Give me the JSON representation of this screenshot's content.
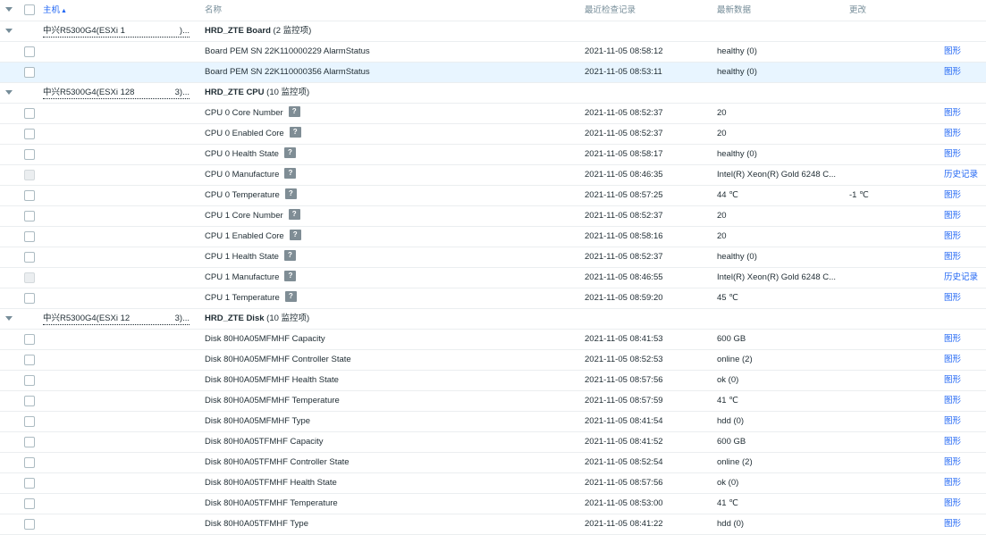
{
  "header": {
    "host": "主机",
    "sort_icon": "▲",
    "name": "名称",
    "last_check": "最近检查记录",
    "latest_data": "最新数据",
    "change": "更改"
  },
  "groups": [
    {
      "host": "中兴R5300G4(ESXi 1",
      "host_tail": ")...",
      "title": "HRD_ZTE Board",
      "count": " (2 监控项)",
      "items": [
        {
          "name": "Board PEM SN 22K110000229 AlarmStatus",
          "last": "2021-11-05 08:58:12",
          "data": "healthy (0)",
          "change": "",
          "link": "图形",
          "help": false,
          "selected": false,
          "disabled": false
        },
        {
          "name": "Board PEM SN 22K110000356 AlarmStatus",
          "last": "2021-11-05 08:53:11",
          "data": "healthy (0)",
          "change": "",
          "link": "图形",
          "help": false,
          "selected": true,
          "disabled": false
        }
      ]
    },
    {
      "host": "中兴R5300G4(ESXi 128",
      "host_tail": "3)...",
      "title": "HRD_ZTE CPU",
      "count": " (10 监控项)",
      "items": [
        {
          "name": "CPU 0 Core Number",
          "last": "2021-11-05 08:52:37",
          "data": "20",
          "change": "",
          "link": "图形",
          "help": true,
          "selected": false,
          "disabled": false
        },
        {
          "name": "CPU 0 Enabled Core",
          "last": "2021-11-05 08:52:37",
          "data": "20",
          "change": "",
          "link": "图形",
          "help": true,
          "selected": false,
          "disabled": false
        },
        {
          "name": "CPU 0 Health State",
          "last": "2021-11-05 08:58:17",
          "data": "healthy (0)",
          "change": "",
          "link": "图形",
          "help": true,
          "selected": false,
          "disabled": false
        },
        {
          "name": "CPU 0 Manufacture",
          "last": "2021-11-05 08:46:35",
          "data": "Intel(R) Xeon(R) Gold 6248 C...",
          "change": "",
          "link": "历史记录",
          "help": true,
          "selected": false,
          "disabled": true
        },
        {
          "name": "CPU 0 Temperature",
          "last": "2021-11-05 08:57:25",
          "data": "44 ℃",
          "change": "-1 ℃",
          "link": "图形",
          "help": true,
          "selected": false,
          "disabled": false
        },
        {
          "name": "CPU 1 Core Number",
          "last": "2021-11-05 08:52:37",
          "data": "20",
          "change": "",
          "link": "图形",
          "help": true,
          "selected": false,
          "disabled": false
        },
        {
          "name": "CPU 1 Enabled Core",
          "last": "2021-11-05 08:58:16",
          "data": "20",
          "change": "",
          "link": "图形",
          "help": true,
          "selected": false,
          "disabled": false
        },
        {
          "name": "CPU 1 Health State",
          "last": "2021-11-05 08:52:37",
          "data": "healthy (0)",
          "change": "",
          "link": "图形",
          "help": true,
          "selected": false,
          "disabled": false
        },
        {
          "name": "CPU 1 Manufacture",
          "last": "2021-11-05 08:46:55",
          "data": "Intel(R) Xeon(R) Gold 6248 C...",
          "change": "",
          "link": "历史记录",
          "help": true,
          "selected": false,
          "disabled": true
        },
        {
          "name": "CPU 1 Temperature",
          "last": "2021-11-05 08:59:20",
          "data": "45 ℃",
          "change": "",
          "link": "图形",
          "help": true,
          "selected": false,
          "disabled": false
        }
      ]
    },
    {
      "host": "中兴R5300G4(ESXi 12",
      "host_tail": "3)...",
      "title": "HRD_ZTE Disk",
      "count": " (10 监控项)",
      "items": [
        {
          "name": "Disk 80H0A05MFMHF Capacity",
          "last": "2021-11-05 08:41:53",
          "data": "600 GB",
          "change": "",
          "link": "图形",
          "help": false,
          "selected": false,
          "disabled": false
        },
        {
          "name": "Disk 80H0A05MFMHF Controller State",
          "last": "2021-11-05 08:52:53",
          "data": "online (2)",
          "change": "",
          "link": "图形",
          "help": false,
          "selected": false,
          "disabled": false
        },
        {
          "name": "Disk 80H0A05MFMHF Health State",
          "last": "2021-11-05 08:57:56",
          "data": "ok (0)",
          "change": "",
          "link": "图形",
          "help": false,
          "selected": false,
          "disabled": false
        },
        {
          "name": "Disk 80H0A05MFMHF Temperature",
          "last": "2021-11-05 08:57:59",
          "data": "41 ℃",
          "change": "",
          "link": "图形",
          "help": false,
          "selected": false,
          "disabled": false
        },
        {
          "name": "Disk 80H0A05MFMHF Type",
          "last": "2021-11-05 08:41:54",
          "data": "hdd (0)",
          "change": "",
          "link": "图形",
          "help": false,
          "selected": false,
          "disabled": false
        },
        {
          "name": "Disk 80H0A05TFMHF Capacity",
          "last": "2021-11-05 08:41:52",
          "data": "600 GB",
          "change": "",
          "link": "图形",
          "help": false,
          "selected": false,
          "disabled": false
        },
        {
          "name": "Disk 80H0A05TFMHF Controller State",
          "last": "2021-11-05 08:52:54",
          "data": "online (2)",
          "change": "",
          "link": "图形",
          "help": false,
          "selected": false,
          "disabled": false
        },
        {
          "name": "Disk 80H0A05TFMHF Health State",
          "last": "2021-11-05 08:57:56",
          "data": "ok (0)",
          "change": "",
          "link": "图形",
          "help": false,
          "selected": false,
          "disabled": false
        },
        {
          "name": "Disk 80H0A05TFMHF Temperature",
          "last": "2021-11-05 08:53:00",
          "data": "41 ℃",
          "change": "",
          "link": "图形",
          "help": false,
          "selected": false,
          "disabled": false
        },
        {
          "name": "Disk 80H0A05TFMHF Type",
          "last": "2021-11-05 08:41:22",
          "data": "hdd (0)",
          "change": "",
          "link": "图形",
          "help": false,
          "selected": false,
          "disabled": false
        }
      ]
    }
  ],
  "icons": {
    "help": "?",
    "collapse": "caret-down-icon"
  },
  "colors": {
    "link": "#1f65f4",
    "selected_row": "#e8f5ff",
    "header_text": "#768d99",
    "help_bg": "#7f8d95"
  }
}
